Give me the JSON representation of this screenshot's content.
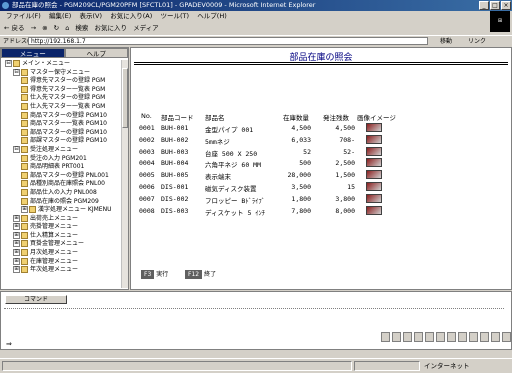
{
  "window": {
    "title": "部品在庫の照会 - PGM209CL/PGM20PFM [SFCTL01] - GPADEV0009 - Microsoft Internet Explorer",
    "buttons": [
      "_",
      "□",
      "×"
    ]
  },
  "menubar": [
    "ファイル(F)",
    "編集(E)",
    "表示(V)",
    "お気に入り(A)",
    "ツール(T)",
    "ヘルプ(H)"
  ],
  "toolbar": {
    "back": "← 戻る",
    "forward": "→",
    "stop": "⊗",
    "refresh": "↻",
    "home": "⌂",
    "search": "検索",
    "favorites": "お気に入り",
    "media": "メディア"
  },
  "addressbar": {
    "label": "アドレス(D)",
    "url": "http://192.168.1.7",
    "go": "移動",
    "links": "リンク"
  },
  "leftpane": {
    "tabs": [
      "メニュー",
      "ヘルプ"
    ],
    "tree": [
      {
        "indent": 0,
        "exp": "⊟",
        "label": "メイン・メニュー"
      },
      {
        "indent": 1,
        "exp": "⊟",
        "label": "マスター保守メニュー"
      },
      {
        "indent": 2,
        "exp": "",
        "label": "得意先マスターの登録 PGM"
      },
      {
        "indent": 2,
        "exp": "",
        "label": "得意先マスター一覧表 PGM"
      },
      {
        "indent": 2,
        "exp": "",
        "label": "仕入先マスターの登録 PGM"
      },
      {
        "indent": 2,
        "exp": "",
        "label": "仕入先マスター一覧表 PGM"
      },
      {
        "indent": 2,
        "exp": "",
        "label": "商品マスターの登録 PGM10"
      },
      {
        "indent": 2,
        "exp": "",
        "label": "商品マスター一覧表 PGM10"
      },
      {
        "indent": 2,
        "exp": "",
        "label": "部品マスターの登録 PGM10"
      },
      {
        "indent": 2,
        "exp": "",
        "label": "部課マスターの登録 PGM10"
      },
      {
        "indent": 1,
        "exp": "⊟",
        "label": "受注処理メニュー"
      },
      {
        "indent": 2,
        "exp": "",
        "label": "受注の入力 PGM201"
      },
      {
        "indent": 2,
        "exp": "",
        "label": "商品明細表 PRT001"
      },
      {
        "indent": 2,
        "exp": "",
        "label": "部品マスターの登録 PNL001"
      },
      {
        "indent": 2,
        "exp": "",
        "label": "品種別商品在庫照会 PNL00"
      },
      {
        "indent": 2,
        "exp": "",
        "label": "部品仕入の入力 PNL008"
      },
      {
        "indent": 2,
        "exp": "",
        "label": "部品在庫の照会 PGM209"
      },
      {
        "indent": 2,
        "exp": "⊞",
        "label": "漢字処理メニュー KJMENU"
      },
      {
        "indent": 1,
        "exp": "⊞",
        "label": "出荷売上メニュー"
      },
      {
        "indent": 1,
        "exp": "⊞",
        "label": "売掛管理メニュー"
      },
      {
        "indent": 1,
        "exp": "⊞",
        "label": "仕入精算メニュー"
      },
      {
        "indent": 1,
        "exp": "⊞",
        "label": "買掛金管理メニュー"
      },
      {
        "indent": 1,
        "exp": "⊞",
        "label": "月次処理メニュー"
      },
      {
        "indent": 1,
        "exp": "⊞",
        "label": "在庫管理メニュー"
      },
      {
        "indent": 1,
        "exp": "⊞",
        "label": "年次処理メニュー"
      }
    ]
  },
  "main": {
    "title": "部品在庫の照会",
    "headers": [
      "No.",
      "部品コード",
      "部品名",
      "在庫数量",
      "発注残数",
      "画像イメージ"
    ],
    "rows": [
      {
        "no": "0001",
        "code": "BUH-001",
        "name": "金型パイプ 001",
        "stock": "4,500",
        "order": "4,500"
      },
      {
        "no": "0002",
        "code": "BUH-002",
        "name": "5mmネジ",
        "stock": "6,033",
        "order": "708-"
      },
      {
        "no": "0003",
        "code": "BUH-003",
        "name": "台座 500 X 250",
        "stock": "52",
        "order": "52-"
      },
      {
        "no": "0004",
        "code": "BUH-004",
        "name": "六角平ネジ 60 MM",
        "stock": "500",
        "order": "2,500"
      },
      {
        "no": "0005",
        "code": "BUH-005",
        "name": "表示端末",
        "stock": "28,000",
        "order": "1,500"
      },
      {
        "no": "0006",
        "code": "DIS-001",
        "name": "磁気ディスク装置",
        "stock": "3,500",
        "order": "15"
      },
      {
        "no": "0007",
        "code": "DIS-002",
        "name": "フロッピー Bﾄﾞﾗｲﾌﾞ",
        "stock": "1,800",
        "order": "3,800"
      },
      {
        "no": "0008",
        "code": "DIS-003",
        "name": "ディスケット 5 ｲﾝﾁ",
        "stock": "7,800",
        "order": "8,000"
      }
    ],
    "fkeys": [
      {
        "key": "F3",
        "label": "実行"
      },
      {
        "key": "F12",
        "label": "終了"
      }
    ]
  },
  "command": {
    "button": "コマンド",
    "prompt": "⇒"
  },
  "status": {
    "zone": "インターネット"
  }
}
